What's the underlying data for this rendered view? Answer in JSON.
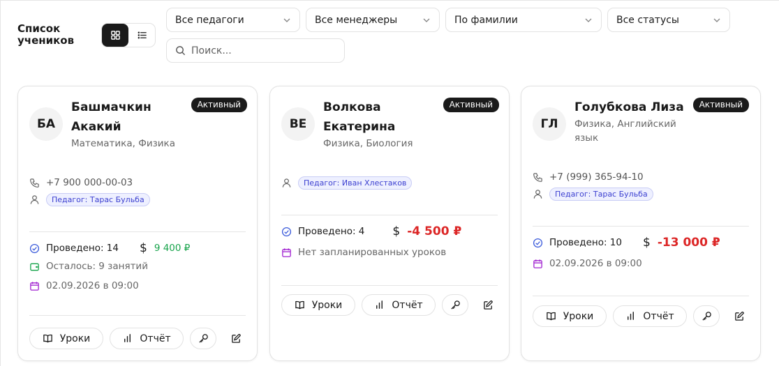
{
  "header": {
    "title": "Список учеников",
    "search_placeholder": "Поиск..."
  },
  "filters": [
    {
      "label": "Все педагоги"
    },
    {
      "label": "Все менеджеры"
    },
    {
      "label": "По фамилии"
    },
    {
      "label": "Все статусы"
    }
  ],
  "actions": {
    "lessons_label": "Уроки",
    "report_label": "Отчёт"
  },
  "colors": {
    "accent_dark": "#1a1a1a",
    "positive": "#16a34a",
    "negative": "#dc2626",
    "teacher_chip": "#3b3fd0",
    "calendar": "#a020d0",
    "check": "#3b5bdb",
    "wallet": "#16a34a"
  },
  "students": [
    {
      "initials": "БА",
      "name_line1": "Башмачкин",
      "name_line2": "Акакий",
      "subjects": "Математика, Физика",
      "status": "Активный",
      "phone": "+7 900 000-00-03",
      "teacher": "Педагог: Тарас Бульба",
      "conducted": "Проведено: 14",
      "balance": "9 400 ₽",
      "remaining": "Осталось: 9 занятий",
      "next_lesson": "02.09.2026 в 09:00"
    },
    {
      "initials": "ВЕ",
      "name_line1": "Волкова",
      "name_line2": "Екатерина",
      "subjects": "Физика, Биология",
      "status": "Активный",
      "teacher": "Педагог: Иван Хлестаков",
      "conducted": "Проведено: 4",
      "balance": "-4 500 ₽",
      "next_lesson": "Нет запланированных уроков"
    },
    {
      "initials": "ГЛ",
      "name_line1": "Голубкова Лиза",
      "subjects_line1": "Физика, Английский",
      "subjects_line2": "язык",
      "status": "Активный",
      "phone": "+7 (999) 365-94-10",
      "teacher": "Педагог: Тарас Бульба",
      "conducted": "Проведено: 10",
      "balance": "-13 000 ₽",
      "next_lesson": "02.09.2026 в 09:00"
    }
  ]
}
